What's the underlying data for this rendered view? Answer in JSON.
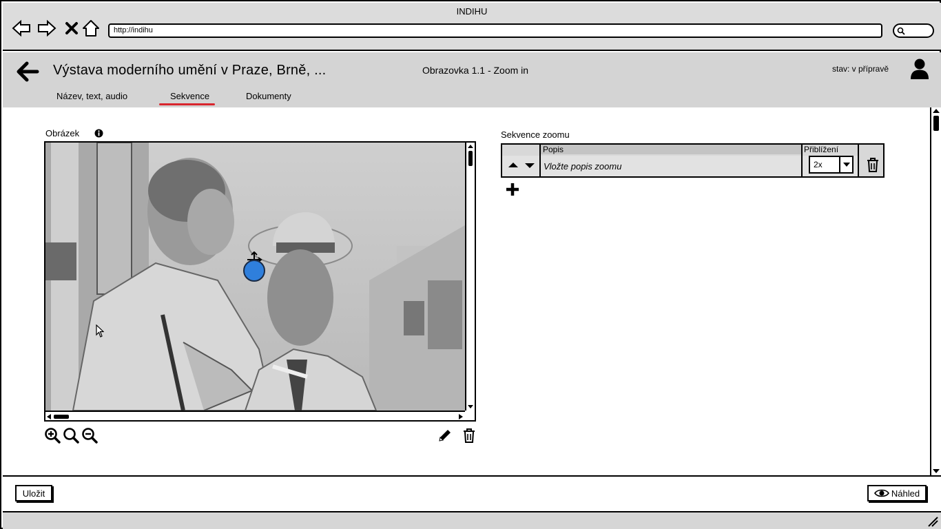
{
  "window": {
    "title": "INDIHU"
  },
  "browser": {
    "url": "http://indihu",
    "icons": [
      "back-icon",
      "forward-icon",
      "close-icon",
      "home-icon",
      "search-icon"
    ]
  },
  "header": {
    "exhibition_title": "Výstava moderního umění v Praze, Brně, ...",
    "screen_title": "Obrazovka 1.1 - Zoom in",
    "state": "stav: v přípravě",
    "tabs": [
      {
        "label": "Název, text, audio",
        "active": false
      },
      {
        "label": "Sekvence",
        "active": true
      },
      {
        "label": "Dokumenty",
        "active": false
      }
    ]
  },
  "image_panel": {
    "label": "Obrázek",
    "tools": [
      "zoom-in-icon",
      "zoom-fit-icon",
      "zoom-out-icon",
      "edit-icon",
      "trash-icon"
    ]
  },
  "sequence": {
    "label": "Sekvence zoomu",
    "columns": {
      "description": "Popis",
      "zoom": "Přiblížení"
    },
    "rows": [
      {
        "description_placeholder": "Vložte popis zoomu",
        "zoom": "2x"
      }
    ]
  },
  "footer": {
    "save_label": "Uložit",
    "preview_label": "Náhled"
  },
  "colors": {
    "accent_tab": "#d9252d",
    "marker": "#2f7fdc"
  }
}
